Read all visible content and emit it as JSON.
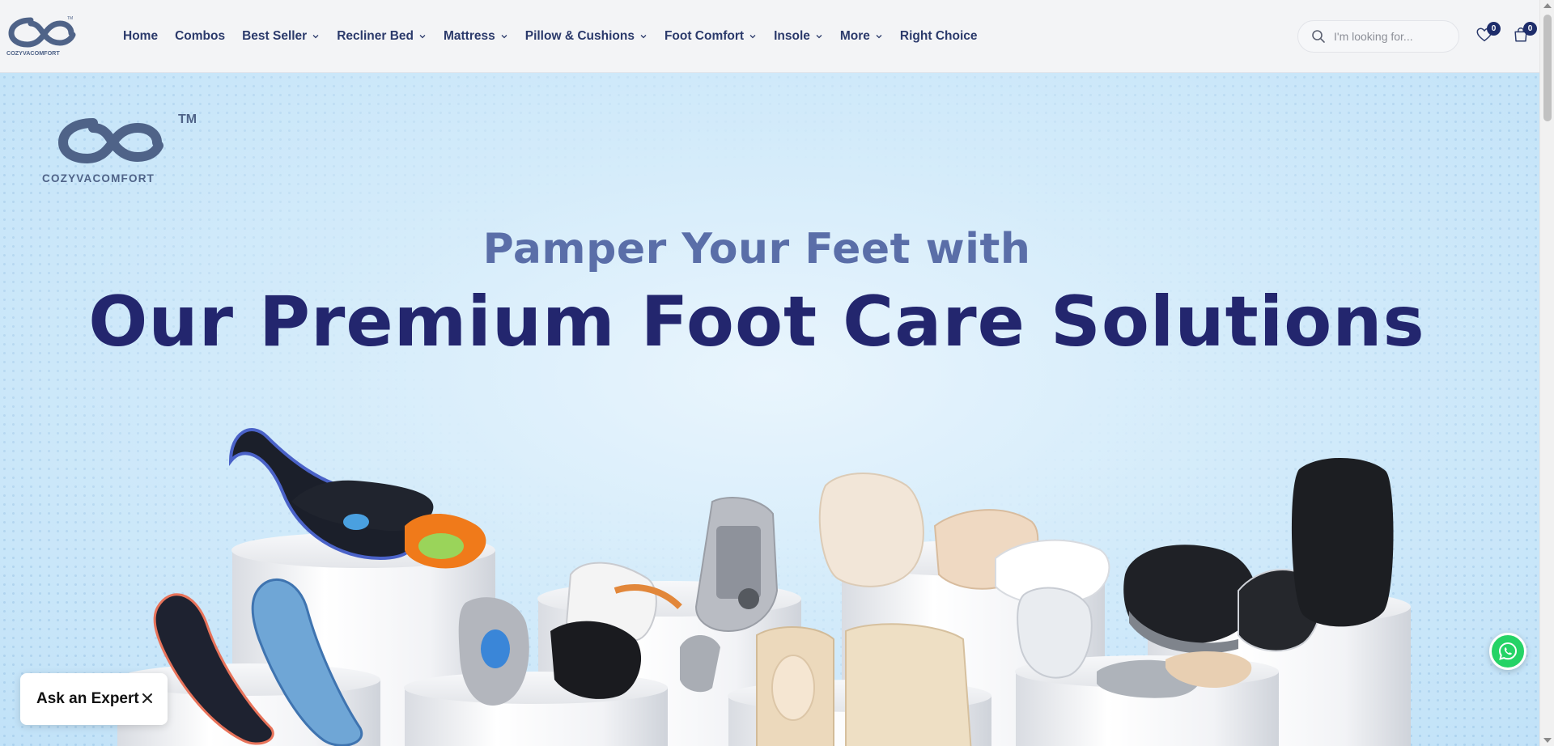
{
  "brand": {
    "name": "COZYVACOMFORT",
    "trademark": "TM",
    "logo_color": "#4f6388"
  },
  "nav": {
    "items": [
      {
        "label": "Home",
        "has_dropdown": false
      },
      {
        "label": "Combos",
        "has_dropdown": false
      },
      {
        "label": "Best Seller",
        "has_dropdown": true
      },
      {
        "label": "Recliner Bed",
        "has_dropdown": true
      },
      {
        "label": "Mattress",
        "has_dropdown": true
      },
      {
        "label": "Pillow & Cushions",
        "has_dropdown": true
      },
      {
        "label": "Foot Comfort",
        "has_dropdown": true
      },
      {
        "label": "Insole",
        "has_dropdown": true
      },
      {
        "label": "More",
        "has_dropdown": true
      },
      {
        "label": "Right Choice",
        "has_dropdown": false
      }
    ]
  },
  "search": {
    "placeholder": "I'm looking for...",
    "icon": "search-icon"
  },
  "header_icons": {
    "wishlist_count": "0",
    "cart_count": "0"
  },
  "hero": {
    "subtitle": "Pamper Your Feet with",
    "title": "Our Premium Foot Care Solutions",
    "title_color": "#23266e",
    "subtitle_color": "#5a6ea8"
  },
  "floating": {
    "expert_label": "Ask an Expert",
    "whatsapp_icon": "whatsapp-icon"
  },
  "colors": {
    "nav_text": "#2b3a6b",
    "badge": "#1e2d6b",
    "header_bg": "#f3f4f6"
  }
}
